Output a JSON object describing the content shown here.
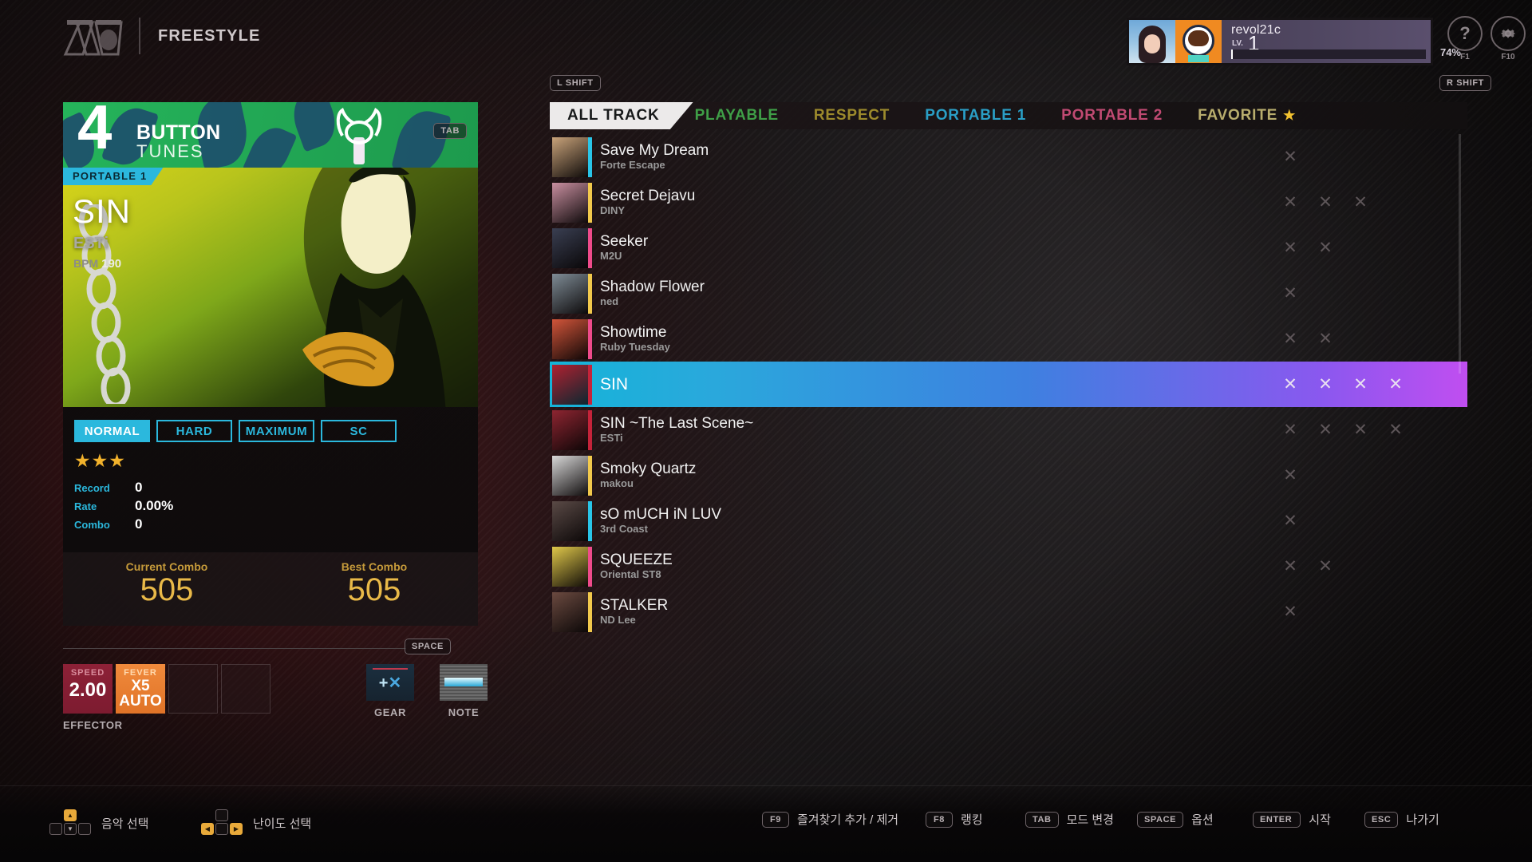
{
  "header": {
    "mode_title": "FREESTYLE",
    "logo_name": "djmax-logo",
    "help_label": "?",
    "help_key": "F1",
    "settings_key": "F10"
  },
  "profile": {
    "name": "revol21c",
    "level_label": "LV.",
    "level": "1",
    "exp_percent": "74%",
    "exp_value": 74
  },
  "left_panel": {
    "button_count": "4",
    "button_word": "BUTTON",
    "tunes_word": "TUNES",
    "tab_key": "TAB",
    "category_badge": "PORTABLE 1",
    "song_title": "SIN",
    "song_artist": "ESTi",
    "bpm_label": "BPM",
    "bpm_value": "190",
    "difficulties": [
      {
        "label": "NORMAL",
        "active": true
      },
      {
        "label": "HARD",
        "active": false
      },
      {
        "label": "MAXIMUM",
        "active": false
      },
      {
        "label": "SC",
        "active": false
      }
    ],
    "stars": "★★★",
    "stats": [
      {
        "key": "Record",
        "value": "0"
      },
      {
        "key": "Rate",
        "value": "0.00%"
      },
      {
        "key": "Combo",
        "value": "0"
      }
    ],
    "current_combo_label": "Current Combo",
    "current_combo_value": "505",
    "best_combo_label": "Best Combo",
    "best_combo_value": "505"
  },
  "effector": {
    "space_key": "SPACE",
    "speed_caption": "SPEED",
    "speed_value": "2.00",
    "fever_caption": "FEVER",
    "fever_value_1": "X5",
    "fever_value_2": "AUTO",
    "effector_label": "EFFECTOR",
    "gear_label": "GEAR",
    "note_label": "NOTE"
  },
  "list": {
    "left_shift_key": "L SHIFT",
    "right_shift_key": "R SHIFT",
    "tabs": [
      {
        "label": "ALL TRACK",
        "color": "#17191a",
        "active": true
      },
      {
        "label": "PLAYABLE",
        "color": "#3f9f47",
        "active": false
      },
      {
        "label": "RESPECT",
        "color": "#9c8a2c",
        "active": false
      },
      {
        "label": "PORTABLE 1",
        "color": "#2a9fc6",
        "active": false
      },
      {
        "label": "PORTABLE 2",
        "color": "#c04a72",
        "active": false
      },
      {
        "label": "FAVORITE",
        "color": "#b8ad6d",
        "active": false,
        "star": "★"
      }
    ],
    "rows": [
      {
        "title": "Save My Dream",
        "artist": "Forte Escape",
        "accent": "#29c5e8",
        "thumb": "#c9a37a",
        "marks": 1,
        "selected": false
      },
      {
        "title": "Secret Dejavu",
        "artist": "DINY",
        "accent": "#f2c94c",
        "thumb": "#c98fa0",
        "marks": 3,
        "selected": false
      },
      {
        "title": "Seeker",
        "artist": "M2U",
        "accent": "#ef4b8b",
        "thumb": "#3a3f52",
        "marks": 2,
        "selected": false
      },
      {
        "title": "Shadow Flower",
        "artist": "ned",
        "accent": "#f2c94c",
        "thumb": "#7f8c96",
        "marks": 1,
        "selected": false
      },
      {
        "title": "Showtime",
        "artist": "Ruby Tuesday",
        "accent": "#ef4b8b",
        "thumb": "#d2553a",
        "marks": 2,
        "selected": false
      },
      {
        "title": "SIN",
        "artist": "",
        "accent": "#c5233a",
        "thumb": "#b02130",
        "marks": 4,
        "selected": true
      },
      {
        "title": "SIN ~The Last Scene~",
        "artist": "ESTi",
        "accent": "#c5233a",
        "thumb": "#8e2531",
        "marks": 4,
        "selected": false
      },
      {
        "title": "Smoky Quartz",
        "artist": "makou",
        "accent": "#f2c94c",
        "thumb": "#d8d8d8",
        "marks": 1,
        "selected": false
      },
      {
        "title": "sO mUCH iN LUV",
        "artist": "3rd Coast",
        "accent": "#29c5e8",
        "thumb": "#5a4a46",
        "marks": 1,
        "selected": false
      },
      {
        "title": "SQUEEZE",
        "artist": "Oriental ST8",
        "accent": "#ef4b8b",
        "thumb": "#e0c84a",
        "marks": 2,
        "selected": false
      },
      {
        "title": "STALKER",
        "artist": "ND Lee",
        "accent": "#f2c94c",
        "thumb": "#6b4a40",
        "marks": 1,
        "selected": false
      }
    ],
    "mark_glyph": "✕"
  },
  "bottom": {
    "music_select_label": "음악 선택",
    "difficulty_select_label": "난이도 선택",
    "shortcuts": [
      {
        "key": "F9",
        "label": "즐겨찾기 추가 / 제거"
      },
      {
        "key": "F8",
        "label": "랭킹"
      },
      {
        "key": "TAB",
        "label": "모드 변경"
      },
      {
        "key": "SPACE",
        "label": "옵션"
      },
      {
        "key": "ENTER",
        "label": "시작"
      },
      {
        "key": "ESC",
        "label": "나가기"
      }
    ]
  }
}
